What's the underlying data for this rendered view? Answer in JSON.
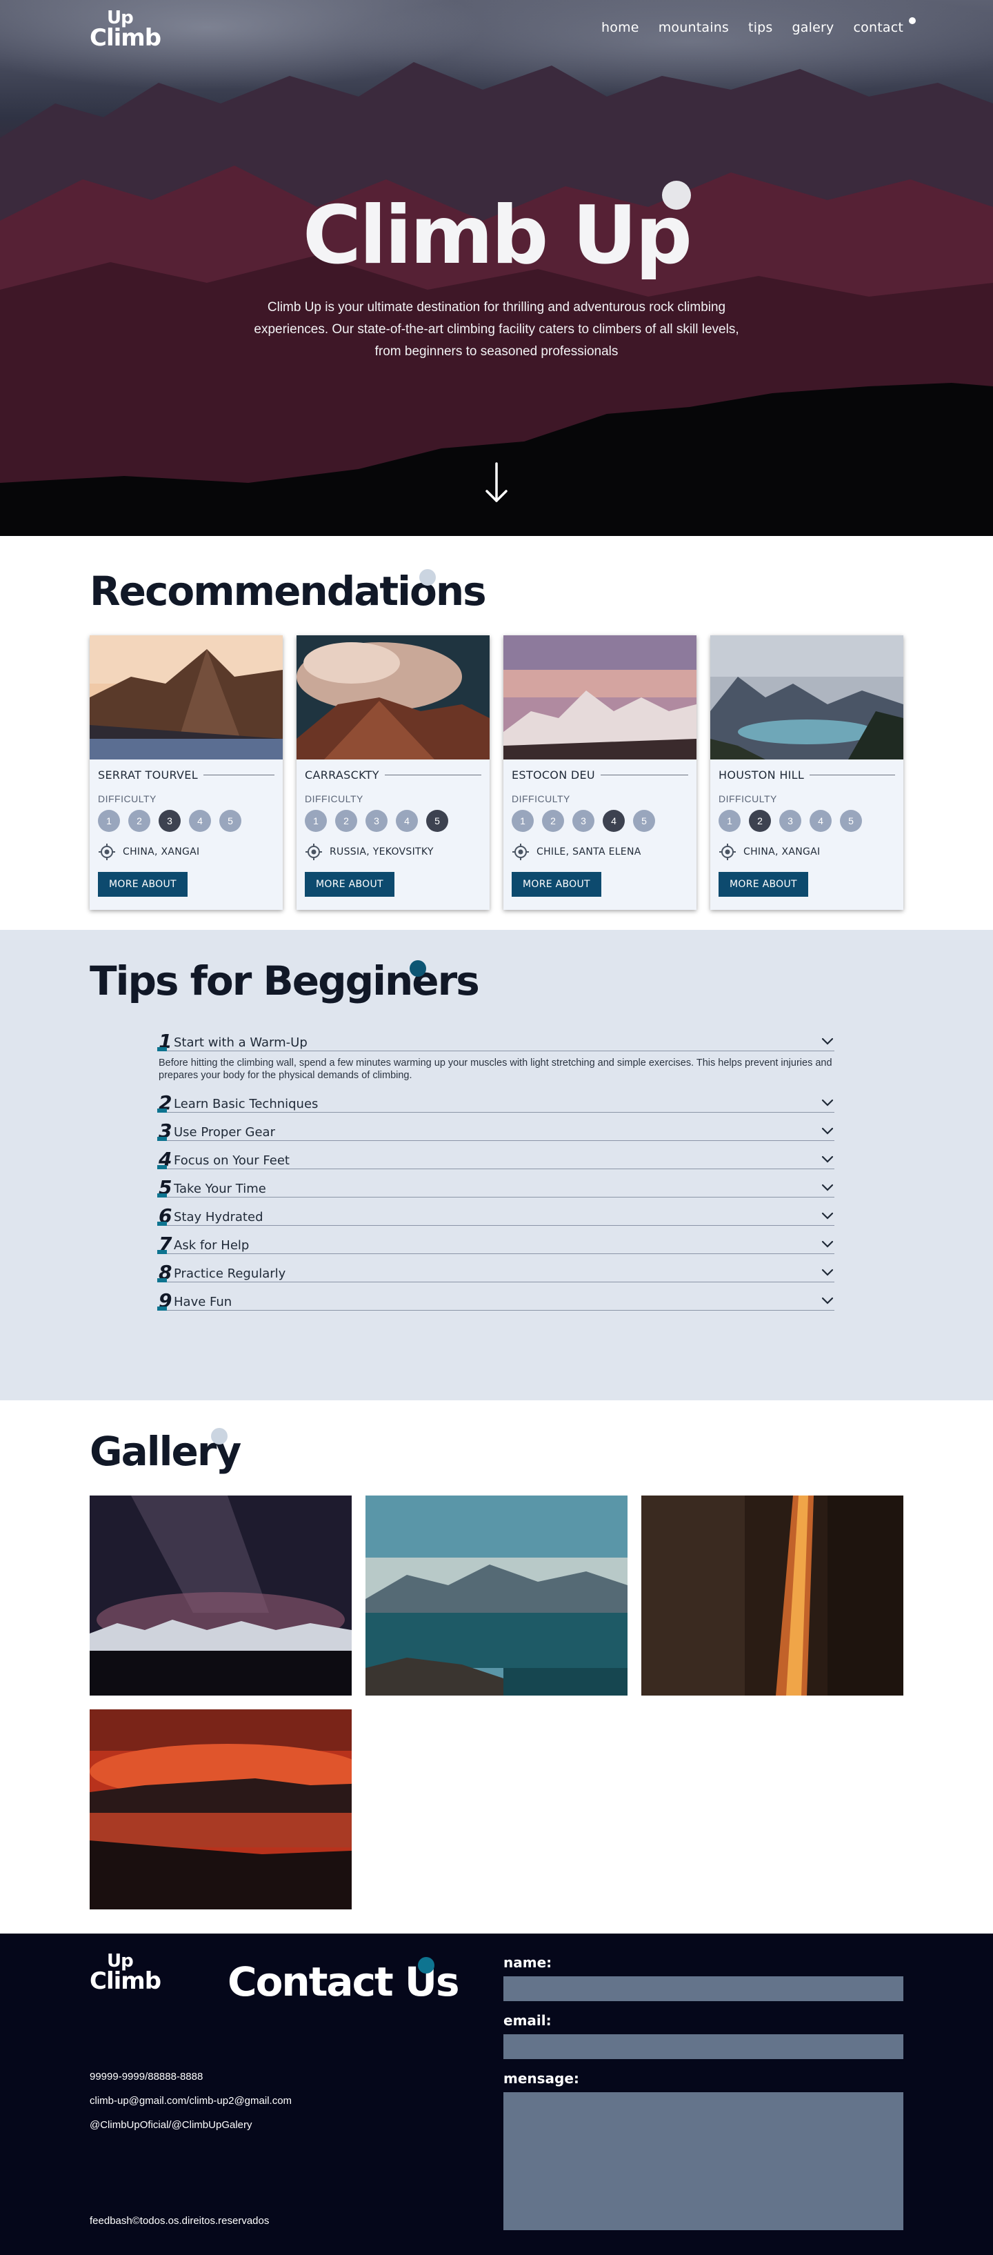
{
  "header": {
    "logo_top": "Up",
    "logo_bottom": "Climb",
    "nav": [
      "home",
      "mountains",
      "tips",
      "galery",
      "contact"
    ]
  },
  "hero": {
    "title": "Climb Up",
    "description": "Climb Up is your ultimate destination for thrilling and adventurous rock climbing experiences. Our state-of-the-art climbing facility caters to climbers of all skill levels, from beginners to seasoned professionals",
    "scroll_icon": "arrow-down-icon"
  },
  "recommendations": {
    "title": "Recommendations",
    "difficulty_label": "DIFFICULTY",
    "button_label": "MORE ABOUT",
    "levels": [
      "1",
      "2",
      "3",
      "4",
      "5"
    ],
    "items": [
      {
        "name": "SERRAT TOURVEL",
        "difficulty": 3,
        "location": "CHINA, XANGAI"
      },
      {
        "name": "CARRASCKTY",
        "difficulty": 5,
        "location": "RUSSIA, YEKOVSITKY"
      },
      {
        "name": "ESTOCON DEU",
        "difficulty": 4,
        "location": "CHILE, SANTA ELENA"
      },
      {
        "name": "HOUSTON HILL",
        "difficulty": 2,
        "location": "CHINA, XANGAI"
      }
    ]
  },
  "tips": {
    "title": "Tips for Begginers",
    "items": [
      {
        "num": "1",
        "title": "Start with a Warm-Up",
        "body": "Before hitting the climbing wall, spend a few minutes warming up your muscles with light stretching and simple exercises. This helps prevent injuries and prepares your body for the physical demands of climbing."
      },
      {
        "num": "2",
        "title": "Learn Basic Techniques"
      },
      {
        "num": "3",
        "title": "Use Proper Gear"
      },
      {
        "num": "4",
        "title": "Focus on Your Feet"
      },
      {
        "num": "5",
        "title": "Take Your Time"
      },
      {
        "num": "6",
        "title": "Stay Hydrated"
      },
      {
        "num": "7",
        "title": "Ask for Help"
      },
      {
        "num": "8",
        "title": "Practice Regularly"
      },
      {
        "num": "9",
        "title": "Have Fun"
      }
    ]
  },
  "gallery": {
    "title": "Gallery"
  },
  "contact": {
    "title": "Contact Us",
    "phone": "99999-9999/88888-8888",
    "email": "climb-up@gmail.com/climb-up2@gmail.com",
    "social": "@ClimbUpOficial/@ClimbUpGalery",
    "footer": "feedbash©todos.os.direitos.reservados",
    "form": {
      "name_label": "name:",
      "email_label": "email:",
      "message_label": "mensage:"
    }
  },
  "colors": {
    "accent": "#0d4a6e",
    "tips_bg": "#dfe5ee",
    "footer_bg": "#05071a",
    "difficulty_dot": "#99a6bd",
    "difficulty_active": "#3d4250"
  }
}
